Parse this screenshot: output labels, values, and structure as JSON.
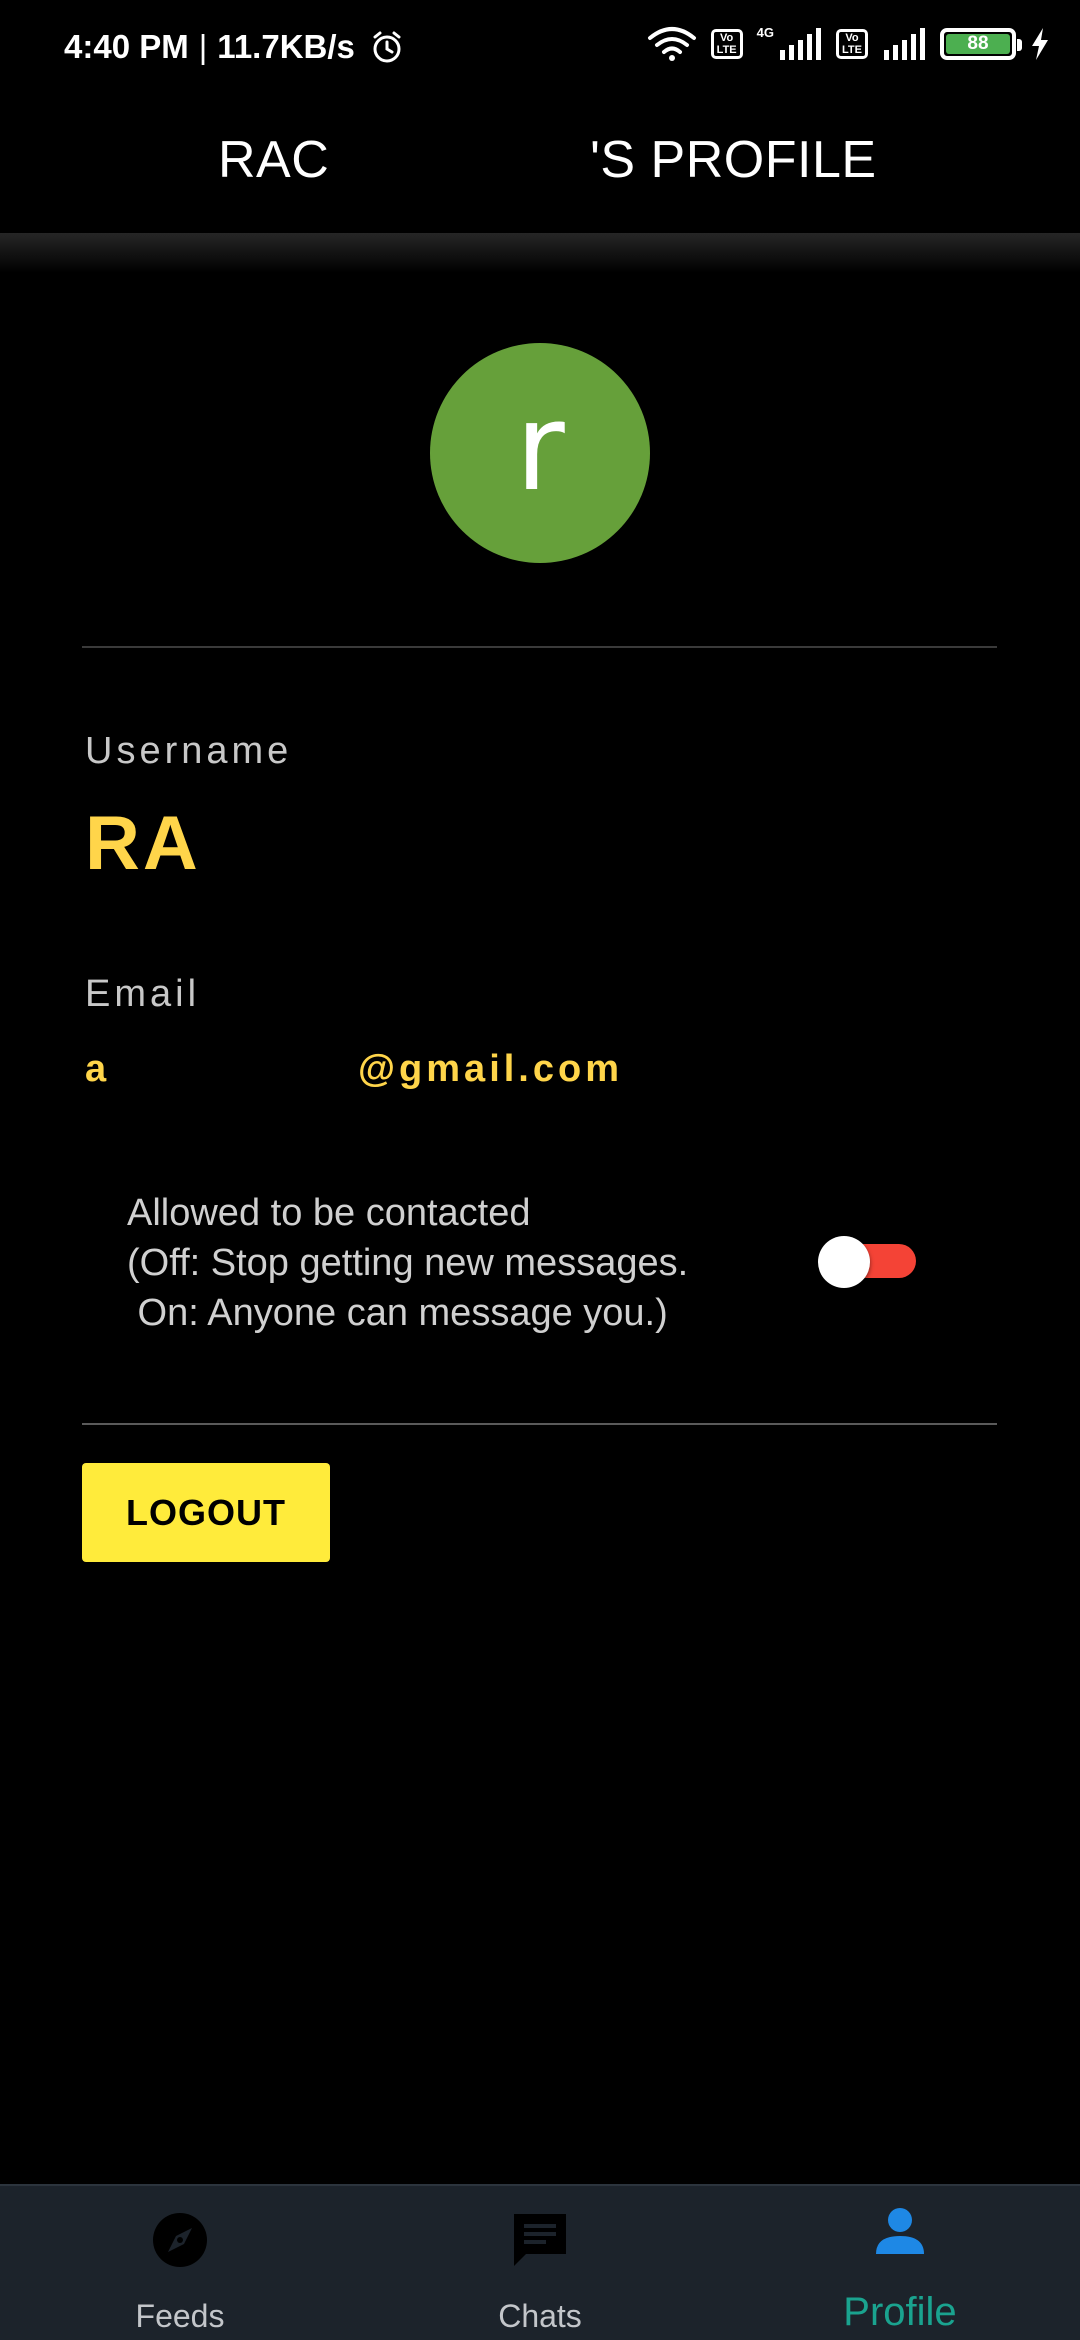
{
  "status_bar": {
    "time": "4:40 PM",
    "separator": "|",
    "speed": "11.7KB/s",
    "network_label": "4G",
    "volte_label_top": "Vo",
    "volte_label_bottom": "LTE",
    "battery_level": "88",
    "icons": [
      "alarm-icon",
      "wifi-icon",
      "signal-icon",
      "charging-icon"
    ]
  },
  "app_bar": {
    "title_left": "RAC",
    "title_right": "'S PROFILE"
  },
  "profile": {
    "avatar_letter": "r",
    "avatar_color": "#66a03a",
    "username_label": "Username",
    "username_value": "RA",
    "email_label": "Email",
    "email_prefix": "a",
    "email_domain": "@gmail.com",
    "accent_color": "#ffd54a"
  },
  "contact_setting": {
    "line1": "Allowed to be contacted",
    "line2": "(Off: Stop getting new messages.",
    "line3": " On: Anyone can message you.)",
    "toggle_state": "off"
  },
  "actions": {
    "logout_label": "LOGOUT"
  },
  "bottom_nav": {
    "items": [
      {
        "label": "Feeds",
        "icon": "compass-icon",
        "active": false
      },
      {
        "label": "Chats",
        "icon": "chat-icon",
        "active": false
      },
      {
        "label": "Profile",
        "icon": "person-icon",
        "active": true
      }
    ],
    "active_color": "#1aa38f",
    "active_icon_color": "#1e88e5"
  }
}
